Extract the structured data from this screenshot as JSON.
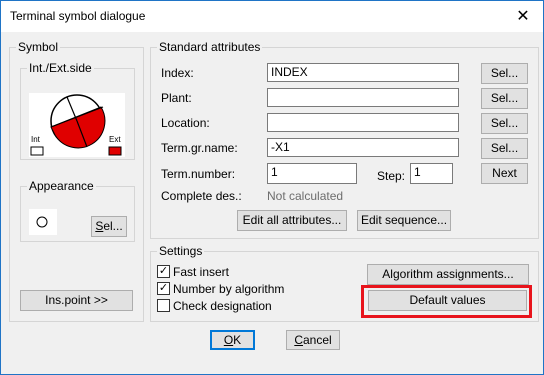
{
  "window": {
    "title": "Terminal symbol dialogue",
    "close_label": "✕"
  },
  "symbol": {
    "group_label": "Symbol",
    "int_ext_label": "Int./Ext.side",
    "preview_labels": {
      "left": "Int",
      "right": "Ext"
    },
    "appearance_label": "Appearance",
    "appearance_sel": "Sel...",
    "ins_point": "Ins.point >>"
  },
  "standard": {
    "group_label": "Standard attributes",
    "index_label": "Index:",
    "index_value": "INDEX",
    "plant_label": "Plant:",
    "plant_value": "",
    "location_label": "Location:",
    "location_value": "",
    "termgr_label": "Term.gr.name:",
    "termgr_value": "-X1",
    "termnum_label": "Term.number:",
    "termnum_value": "1",
    "step_label": "Step:",
    "step_value": "1",
    "next": "Next",
    "complete_label": "Complete des.:",
    "complete_value": "Not calculated",
    "sel": "Sel...",
    "edit_all": "Edit all attributes...",
    "edit_seq": "Edit sequence..."
  },
  "settings": {
    "group_label": "Settings",
    "fast_insert": "Fast insert",
    "fast_insert_checked": true,
    "number_by_algorithm": "Number by algorithm",
    "number_by_algorithm_checked": true,
    "check_designation": "Check designation",
    "check_designation_checked": false,
    "algorithm_assignments": "Algorithm assignments...",
    "default_values": "Default values"
  },
  "footer": {
    "ok": "OK",
    "cancel": "Cancel"
  },
  "colors": {
    "highlight": "#e8141c",
    "accent": "#0078d7",
    "symbol_fill": "#e00000"
  }
}
